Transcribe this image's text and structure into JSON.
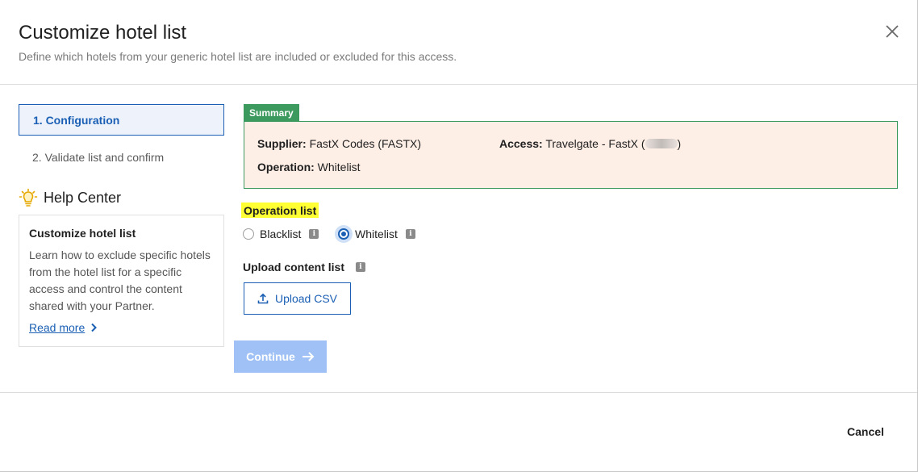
{
  "dialog": {
    "title": "Customize hotel list",
    "subtitle": "Define which hotels from your generic hotel list are included or excluded for this access.",
    "close_icon": "close-icon"
  },
  "steps": [
    {
      "label": "1. Configuration",
      "active": true
    },
    {
      "label": "2. Validate list and confirm",
      "active": false
    }
  ],
  "help_center": {
    "icon": "lightbulb-icon",
    "title": "Help Center",
    "card_title": "Customize hotel list",
    "card_text": "Learn how to exclude specific hotels from the hotel list for a specific access and control the content shared with your Partner.",
    "read_more": "Read more"
  },
  "summary": {
    "tag": "Summary",
    "supplier_label": "Supplier:",
    "supplier_value": "FastX Codes (FASTX)",
    "access_label": "Access:",
    "access_value_prefix": "Travelgate - FastX (",
    "access_value_suffix": ")",
    "operation_label": "Operation:",
    "operation_value": "Whitelist"
  },
  "operation_list": {
    "label": "Operation list",
    "options": [
      {
        "label": "Blacklist",
        "selected": false
      },
      {
        "label": "Whitelist",
        "selected": true
      }
    ]
  },
  "upload": {
    "label": "Upload content list",
    "button": "Upload CSV"
  },
  "actions": {
    "continue": "Continue",
    "cancel": "Cancel"
  },
  "colors": {
    "primary": "#1a5fb4",
    "summary_green": "#3d9a5e",
    "summary_bg": "#fdeee6",
    "highlight": "#ffff33",
    "continue_disabled": "#9fc1f5"
  }
}
